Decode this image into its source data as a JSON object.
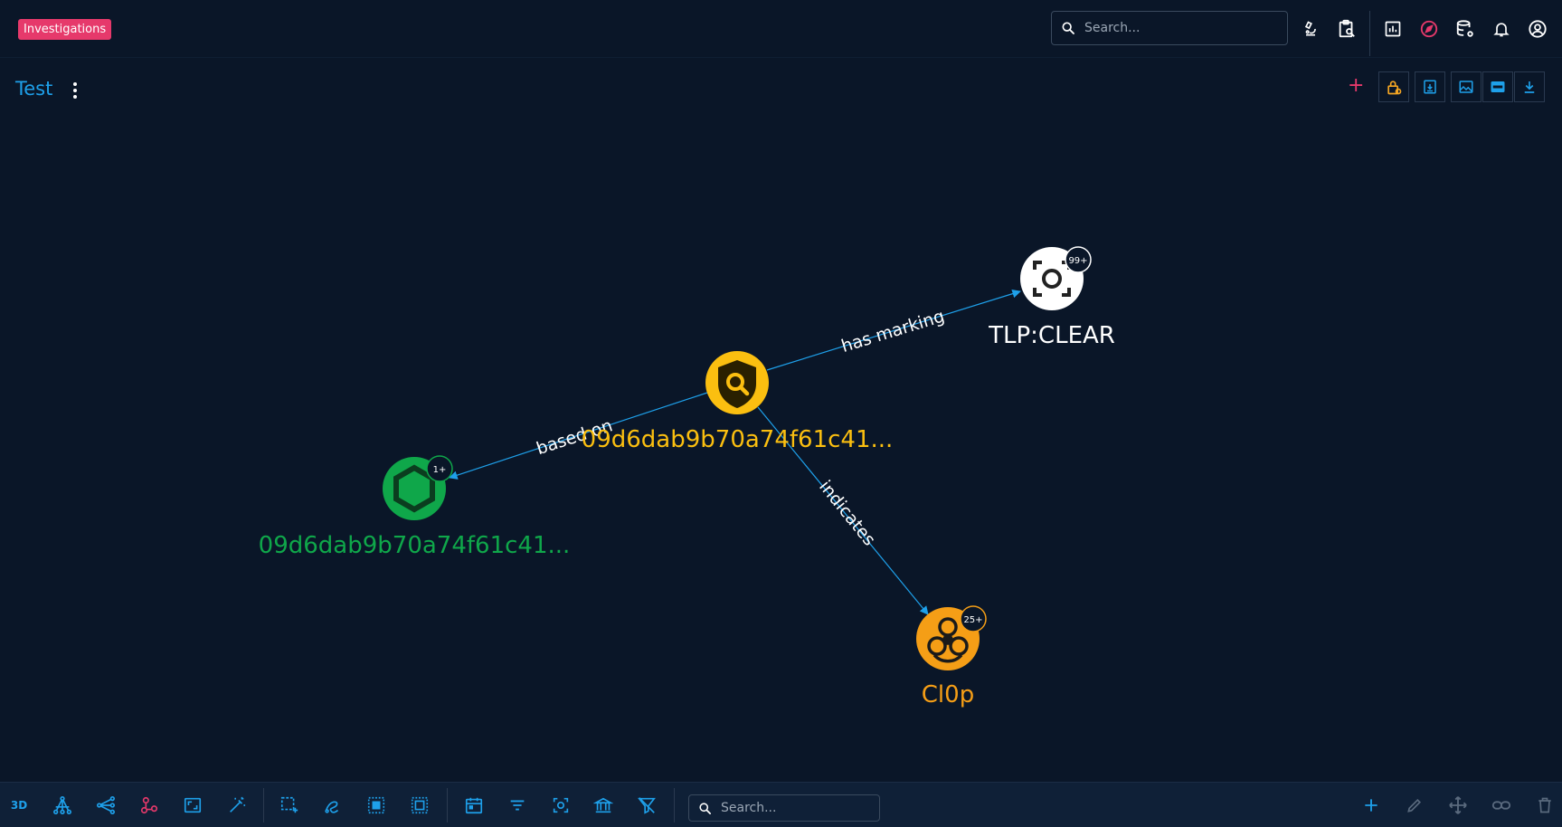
{
  "header": {
    "badge": "Investigations",
    "search": {
      "placeholder": "Search...",
      "value": ""
    }
  },
  "toolbar": {
    "title": "Test"
  },
  "graph": {
    "nodes": [
      {
        "id": "report",
        "label": "09d6dab9b70a74f61c41...",
        "color": "#fbbf10",
        "badge": ""
      },
      {
        "id": "marking",
        "label": "TLP:CLEAR",
        "color": "#ffffff",
        "badge": "99+"
      },
      {
        "id": "indicator",
        "label": "09d6dab9b70a74f61c41...",
        "color": "#0fa74a",
        "badge": "1+"
      },
      {
        "id": "malware",
        "label": "Cl0p",
        "color": "#f59e16",
        "badge": "25+"
      }
    ],
    "edges": [
      {
        "from": "report",
        "to": "marking",
        "label": "has marking"
      },
      {
        "from": "report",
        "to": "indicator",
        "label": "based on"
      },
      {
        "from": "report",
        "to": "malware",
        "label": "indicates"
      }
    ],
    "edge_color": "#1ea0ea"
  },
  "bottom": {
    "mode_label": "3D",
    "search": {
      "placeholder": "Search...",
      "value": ""
    }
  },
  "colors": {
    "accent": "#1ea0ea",
    "brand": "#e6396b",
    "background": "#0a1628",
    "warning": "#f5a623"
  }
}
